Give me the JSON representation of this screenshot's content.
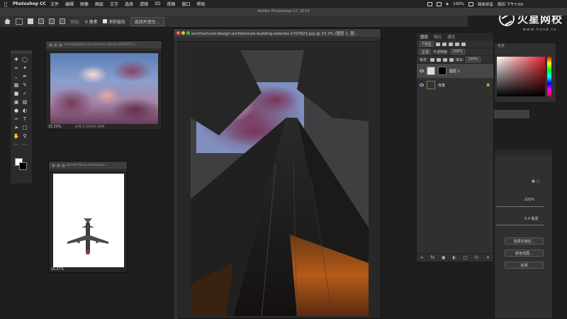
{
  "menubar": {
    "app_name": "Photoshop CC",
    "items": [
      "文件",
      "编辑",
      "图像",
      "图层",
      "文字",
      "选择",
      "滤镜",
      "3D",
      "视图",
      "窗口",
      "帮助"
    ],
    "battery": "100%",
    "input_method": "简体拼音",
    "clock": "周四 下午7:00"
  },
  "watermark": {
    "text": "火星网校",
    "url": "www.hxsd.tv"
  },
  "app_title": "Adobe Photoshop CC 2019",
  "options": {
    "feather_label": "羽化:",
    "feather_value": "0 像素",
    "antialias_label": "消除锯齿",
    "select_mask_button": "选择并遮住..."
  },
  "documents": {
    "clouds": {
      "title": "atmosphere-cloudiness-clouds-844297.j...",
      "zoom": "33.33%",
      "doc_info": "文档:6.99M/6.99M"
    },
    "plane": {
      "title": "air-air-force-air-travel-...",
      "zoom": "16.67%"
    },
    "main": {
      "title": "architectural-design-architecture-building-exterior-1707823.jpg @ 33.3% (图层 1, 图..."
    }
  },
  "layers_panel": {
    "tabs": [
      "图层",
      "路径",
      "通道"
    ],
    "active_tab": 0,
    "filter_kind": "类型",
    "blend_mode": "正常",
    "opacity_label": "不透明度:",
    "opacity_value": "100%",
    "lock_label": "锁定:",
    "fill_label": "填充:",
    "fill_value": "100%",
    "layers": [
      {
        "name": "图层 1",
        "selected": true
      },
      {
        "name": "背景",
        "selected": false
      }
    ],
    "bottom_icons": [
      "link-icon",
      "fx-icon",
      "mask-icon",
      "adjustment-icon",
      "group-icon",
      "new-layer-icon",
      "trash-icon"
    ]
  },
  "color_panel": {
    "tab": "色板"
  },
  "properties_panel": {
    "percent": "100%",
    "value": "0.0 像素",
    "buttons": [
      "选择并遮住...",
      "颜色范围...",
      "反相"
    ]
  }
}
